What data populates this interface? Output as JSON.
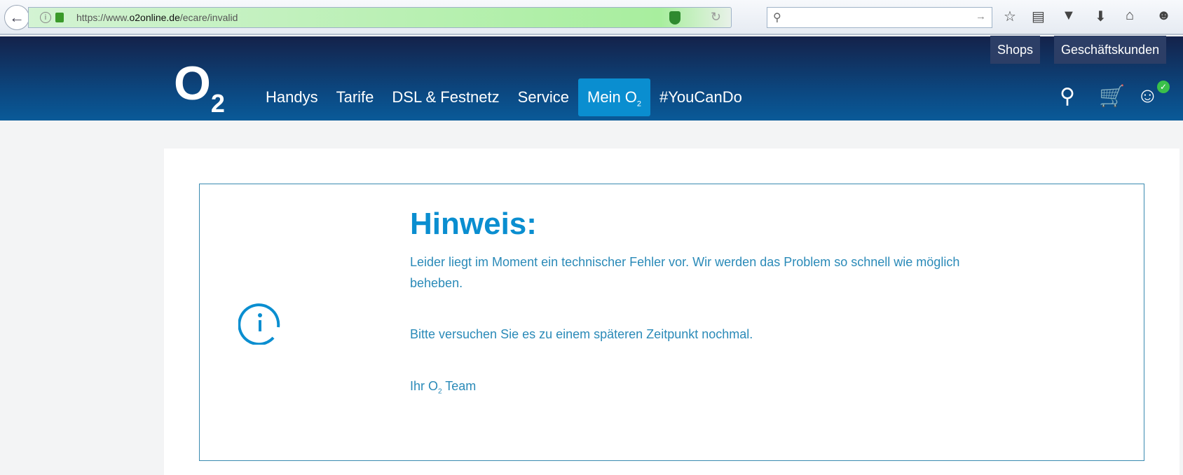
{
  "browser": {
    "url_prefix": "https://www.",
    "url_domain": "o2online.de",
    "url_path": "/ecare/invalid",
    "search_placeholder": ""
  },
  "header": {
    "top_links": [
      "Shops",
      "Geschäftskunden"
    ],
    "logo": "O2",
    "nav": [
      {
        "label": "Handys"
      },
      {
        "label": "Tarife"
      },
      {
        "label": "DSL & Festnetz"
      },
      {
        "label": "Service"
      },
      {
        "label": "Mein O",
        "sub": "2",
        "active": true
      },
      {
        "label": "#YouCanDo"
      }
    ]
  },
  "notice": {
    "title": "Hinweis:",
    "line1": "Leider liegt im Moment ein technischer Fehler vor. Wir werden das Problem so schnell wie möglich beheben.",
    "line2": "Bitte versuchen Sie es zu einem späteren Zeitpunkt nochmal.",
    "sign_prefix": "Ihr O",
    "sign_sub": "2",
    "sign_suffix": " Team"
  },
  "colors": {
    "accent": "#0a8ed0",
    "header": "#0b4a84"
  }
}
